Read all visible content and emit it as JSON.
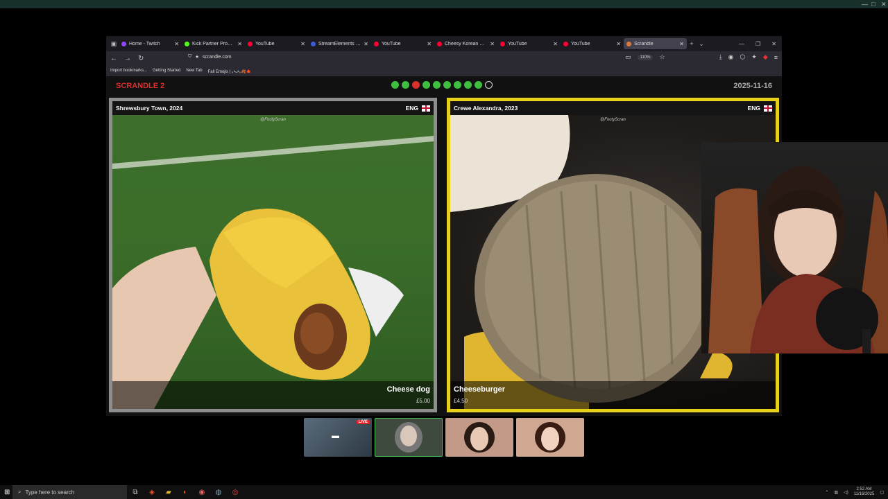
{
  "window_controls": [
    "—",
    "□",
    "✕"
  ],
  "browser": {
    "tabs": [
      {
        "label": "Home - Twitch",
        "color": "#9146ff",
        "active": false
      },
      {
        "label": "Kick Partner Program -",
        "color": "#53fc18",
        "active": false
      },
      {
        "label": "YouTube",
        "color": "#ff0033",
        "active": false
      },
      {
        "label": "StreamElements - My o",
        "color": "#3b5bdb",
        "active": false
      },
      {
        "label": "YouTube",
        "color": "#ff0033",
        "active": false
      },
      {
        "label": "Cheesy Korean Egg To",
        "color": "#ff0033",
        "active": false
      },
      {
        "label": "YouTube",
        "color": "#ff0033",
        "active": false
      },
      {
        "label": "YouTube",
        "color": "#ff0033",
        "active": false
      },
      {
        "label": "Scrandle",
        "color": "#e0763a",
        "active": true
      }
    ],
    "url": "scrandle.com",
    "zoom": "110%",
    "bookmarks": [
      "Import bookmarks...",
      "Getting Started",
      "New Tab",
      "Fall Emojis | ｡•ᴗ•｡🍂🍁"
    ]
  },
  "app": {
    "title": "SCRANDLE 2",
    "date": "2025-11-16",
    "progress": [
      "correct",
      "correct",
      "wrong",
      "correct",
      "correct",
      "correct",
      "correct",
      "correct",
      "correct",
      "pending"
    ],
    "watermark": "@FootyScran",
    "left": {
      "club": "Shrewsbury Town, 2024",
      "country": "ENG",
      "dish": "Cheese dog",
      "price": "£5.00"
    },
    "right": {
      "club": "Crewe Alexandra, 2023",
      "country": "ENG",
      "dish": "Cheeseburger",
      "price": "£4.50"
    }
  },
  "stream": {
    "live_badge": "LIVE"
  },
  "taskbar": {
    "search_placeholder": "Type here to search",
    "time": "2:52 AM",
    "date": "11/16/2025"
  },
  "colors": {
    "accent_red": "#d9302c",
    "correct_green": "#3fbf3f",
    "highlight_yellow": "#e5d11c"
  }
}
